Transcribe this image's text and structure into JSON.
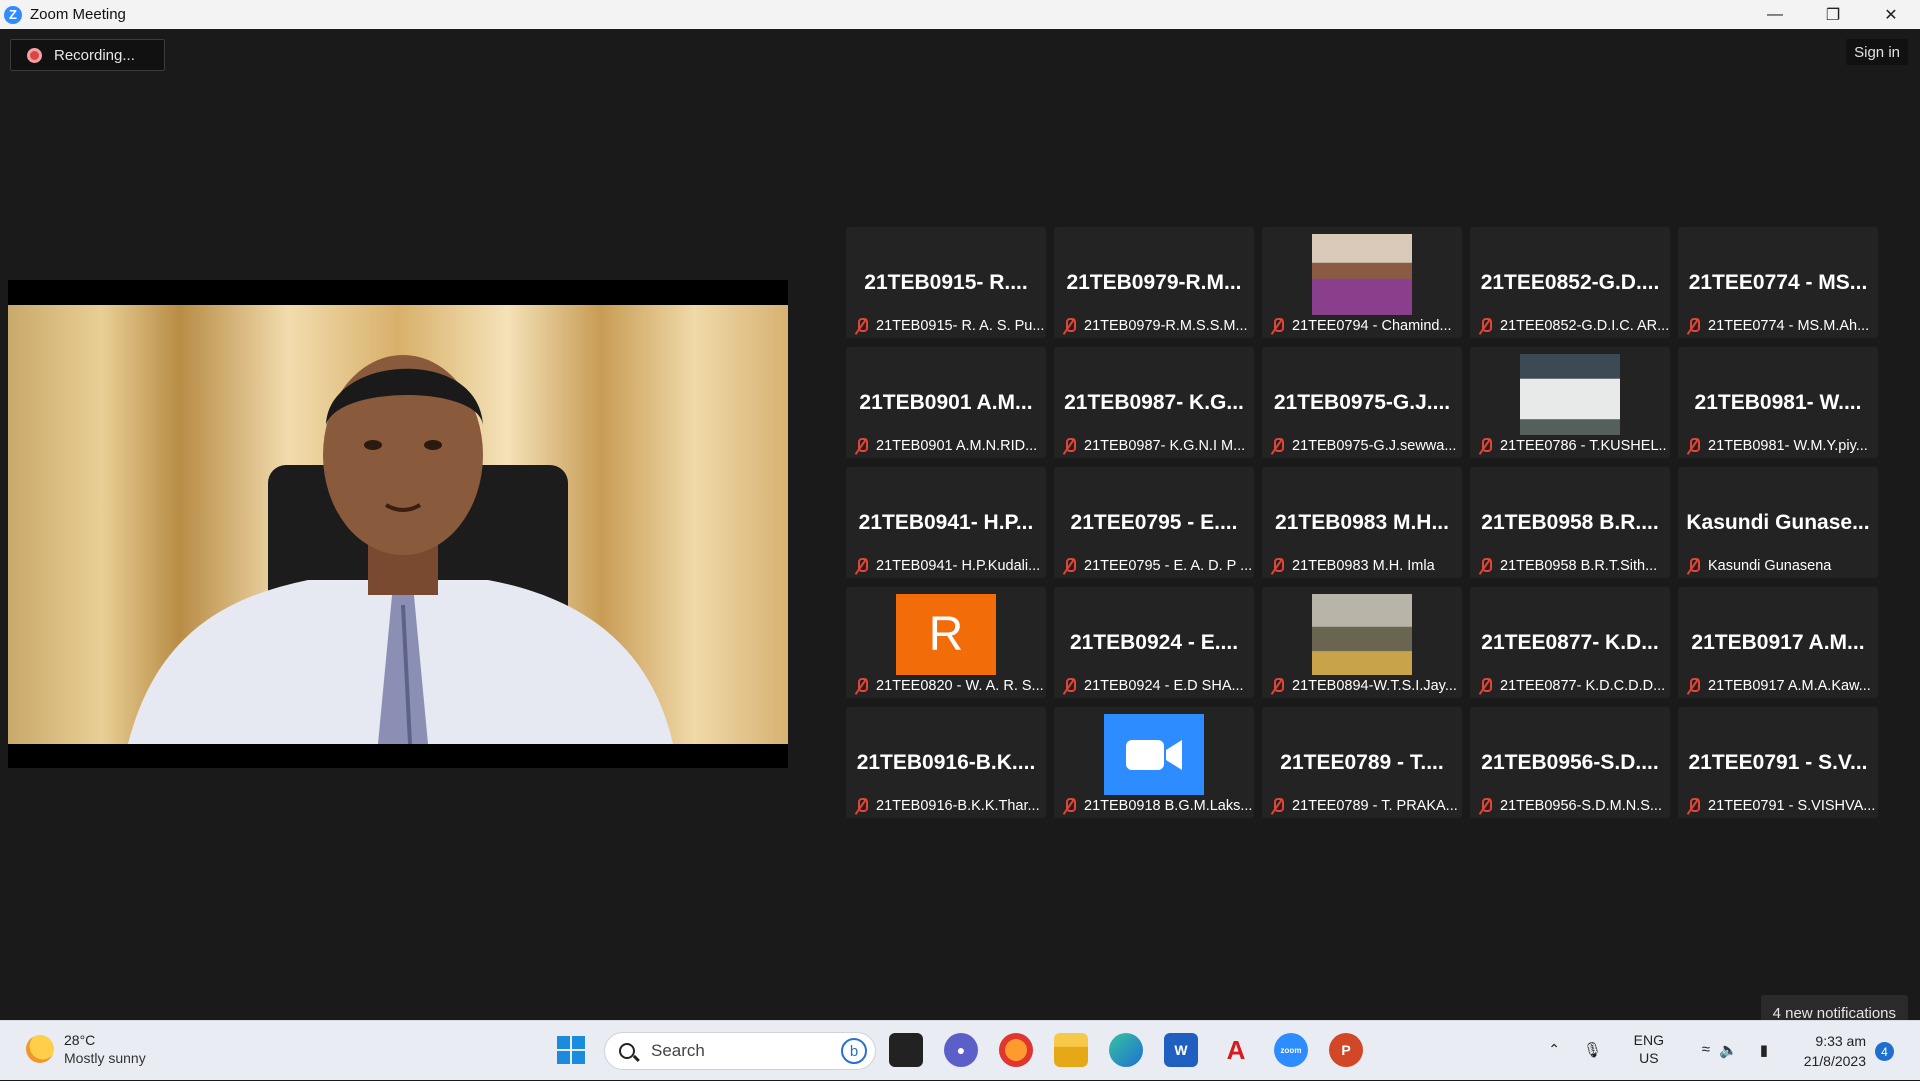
{
  "window": {
    "title": "Zoom Meeting"
  },
  "meeting": {
    "recording_label": "Recording...",
    "signin_label": "Sign in",
    "notification_label": "4 new notifications"
  },
  "tiles": [
    {
      "big": "21TEB0915- R....",
      "label": "21TEB0915- R. A. S. Pu..."
    },
    {
      "big": "21TEB0979-R.M...",
      "label": "21TEB0979-R.M.S.S.M..."
    },
    {
      "big": "",
      "label": "21TEE0794 - Chamind...",
      "avatar": "photo-man"
    },
    {
      "big": "21TEE0852-G.D....",
      "label": "21TEE0852-G.D.I.C. AR..."
    },
    {
      "big": "21TEE0774 - MS...",
      "label": "21TEE0774 - MS.M.Ah..."
    },
    {
      "big": "21TEB0901 A.M...",
      "label": "21TEB0901 A.M.N.RID..."
    },
    {
      "big": "21TEB0987- K.G...",
      "label": "21TEB0987- K.G.N.I M..."
    },
    {
      "big": "21TEB0975-G.J....",
      "label": "21TEB0975-G.J.sewwa..."
    },
    {
      "big": "",
      "label": "21TEE0786 - T.KUSHEL...",
      "avatar": "photo-man-white"
    },
    {
      "big": "21TEB0981- W....",
      "label": "21TEB0981- W.M.Y.piy..."
    },
    {
      "big": "21TEB0941- H.P...",
      "label": "21TEB0941- H.P.Kudali..."
    },
    {
      "big": "21TEE0795 - E....",
      "label": "21TEE0795 - E. A. D. P ..."
    },
    {
      "big": "21TEB0983 M.H...",
      "label": "21TEB0983 M.H. Imla"
    },
    {
      "big": "21TEB0958 B.R....",
      "label": "21TEB0958 B.R.T.Sith..."
    },
    {
      "big": "Kasundi Gunase...",
      "label": "Kasundi Gunasena"
    },
    {
      "big": "",
      "label": "21TEE0820 - W. A. R. S...",
      "avatar": "letter-r",
      "letter": "R"
    },
    {
      "big": "21TEB0924 - E....",
      "label": "21TEB0924 - E.D SHA..."
    },
    {
      "big": "",
      "label": "21TEB0894-W.T.S.I.Jay...",
      "avatar": "photo-cap"
    },
    {
      "big": "21TEE0877- K.D...",
      "label": "21TEE0877- K.D.C.D.D..."
    },
    {
      "big": "21TEB0917 A.M...",
      "label": "21TEB0917 A.M.A.Kaw..."
    },
    {
      "big": "21TEB0916-B.K....",
      "label": "21TEB0916-B.K.K.Thar..."
    },
    {
      "big": "",
      "label": "21TEB0918 B.G.M.Laks...",
      "avatar": "zoom-logo"
    },
    {
      "big": "21TEE0789 - T....",
      "label": "21TEE0789 - T. PRAKA..."
    },
    {
      "big": "21TEB0956-S.D....",
      "label": "21TEB0956-S.D.M.N.S..."
    },
    {
      "big": "21TEE0791 - S.V...",
      "label": "21TEE0791 - S.VISHVA..."
    }
  ],
  "taskbar": {
    "weather_temp": "28°C",
    "weather_cond": "Mostly sunny",
    "search_label": "Search",
    "lang_1": "ENG",
    "lang_2": "US",
    "time": "9:33 am",
    "date": "21/8/2023",
    "notif_count": "4"
  },
  "colors": {
    "zoom_blue": "#2d8cff",
    "mic_muted": "#e0453a",
    "avatar_orange": "#f26c0a"
  }
}
